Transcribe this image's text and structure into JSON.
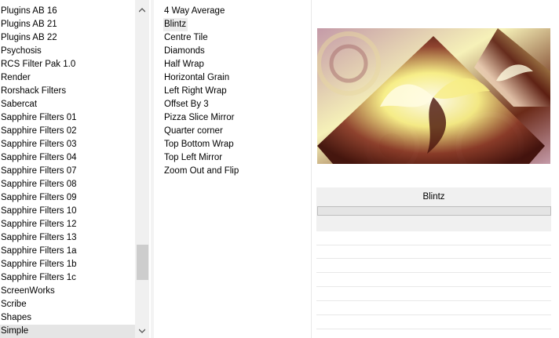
{
  "categories": {
    "items": [
      "Plugins AB 16",
      "Plugins AB 21",
      "Plugins AB 22",
      "Psychosis",
      "RCS Filter Pak 1.0",
      "Render",
      "Rorshack Filters",
      "Sabercat",
      "Sapphire Filters 01",
      "Sapphire Filters 02",
      "Sapphire Filters 03",
      "Sapphire Filters 04",
      "Sapphire Filters 07",
      "Sapphire Filters 08",
      "Sapphire Filters 09",
      "Sapphire Filters 10",
      "Sapphire Filters 12",
      "Sapphire Filters 13",
      "Sapphire Filters 1a",
      "Sapphire Filters 1b",
      "Sapphire Filters 1c",
      "ScreenWorks",
      "Scribe",
      "Shapes",
      "Simple"
    ],
    "selected": "Simple"
  },
  "filters": {
    "items": [
      "4 Way Average",
      "Blintz",
      "Centre Tile",
      "Diamonds",
      "Half Wrap",
      "Horizontal Grain",
      "Left Right Wrap",
      "Offset By 3",
      "Pizza Slice Mirror",
      "Quarter corner",
      "Top Bottom Wrap",
      "Top Left Mirror",
      "Zoom Out and Flip"
    ],
    "selected": "Blintz"
  },
  "preview": {
    "filter_name": "Blintz",
    "colors": {
      "cream": "#f6f1b8",
      "brown": "#5a1c10",
      "mauve": "#c49aa8",
      "yellow": "#f7ee86"
    }
  },
  "icons": {
    "scroll_up": "▲",
    "scroll_down": "▼"
  }
}
